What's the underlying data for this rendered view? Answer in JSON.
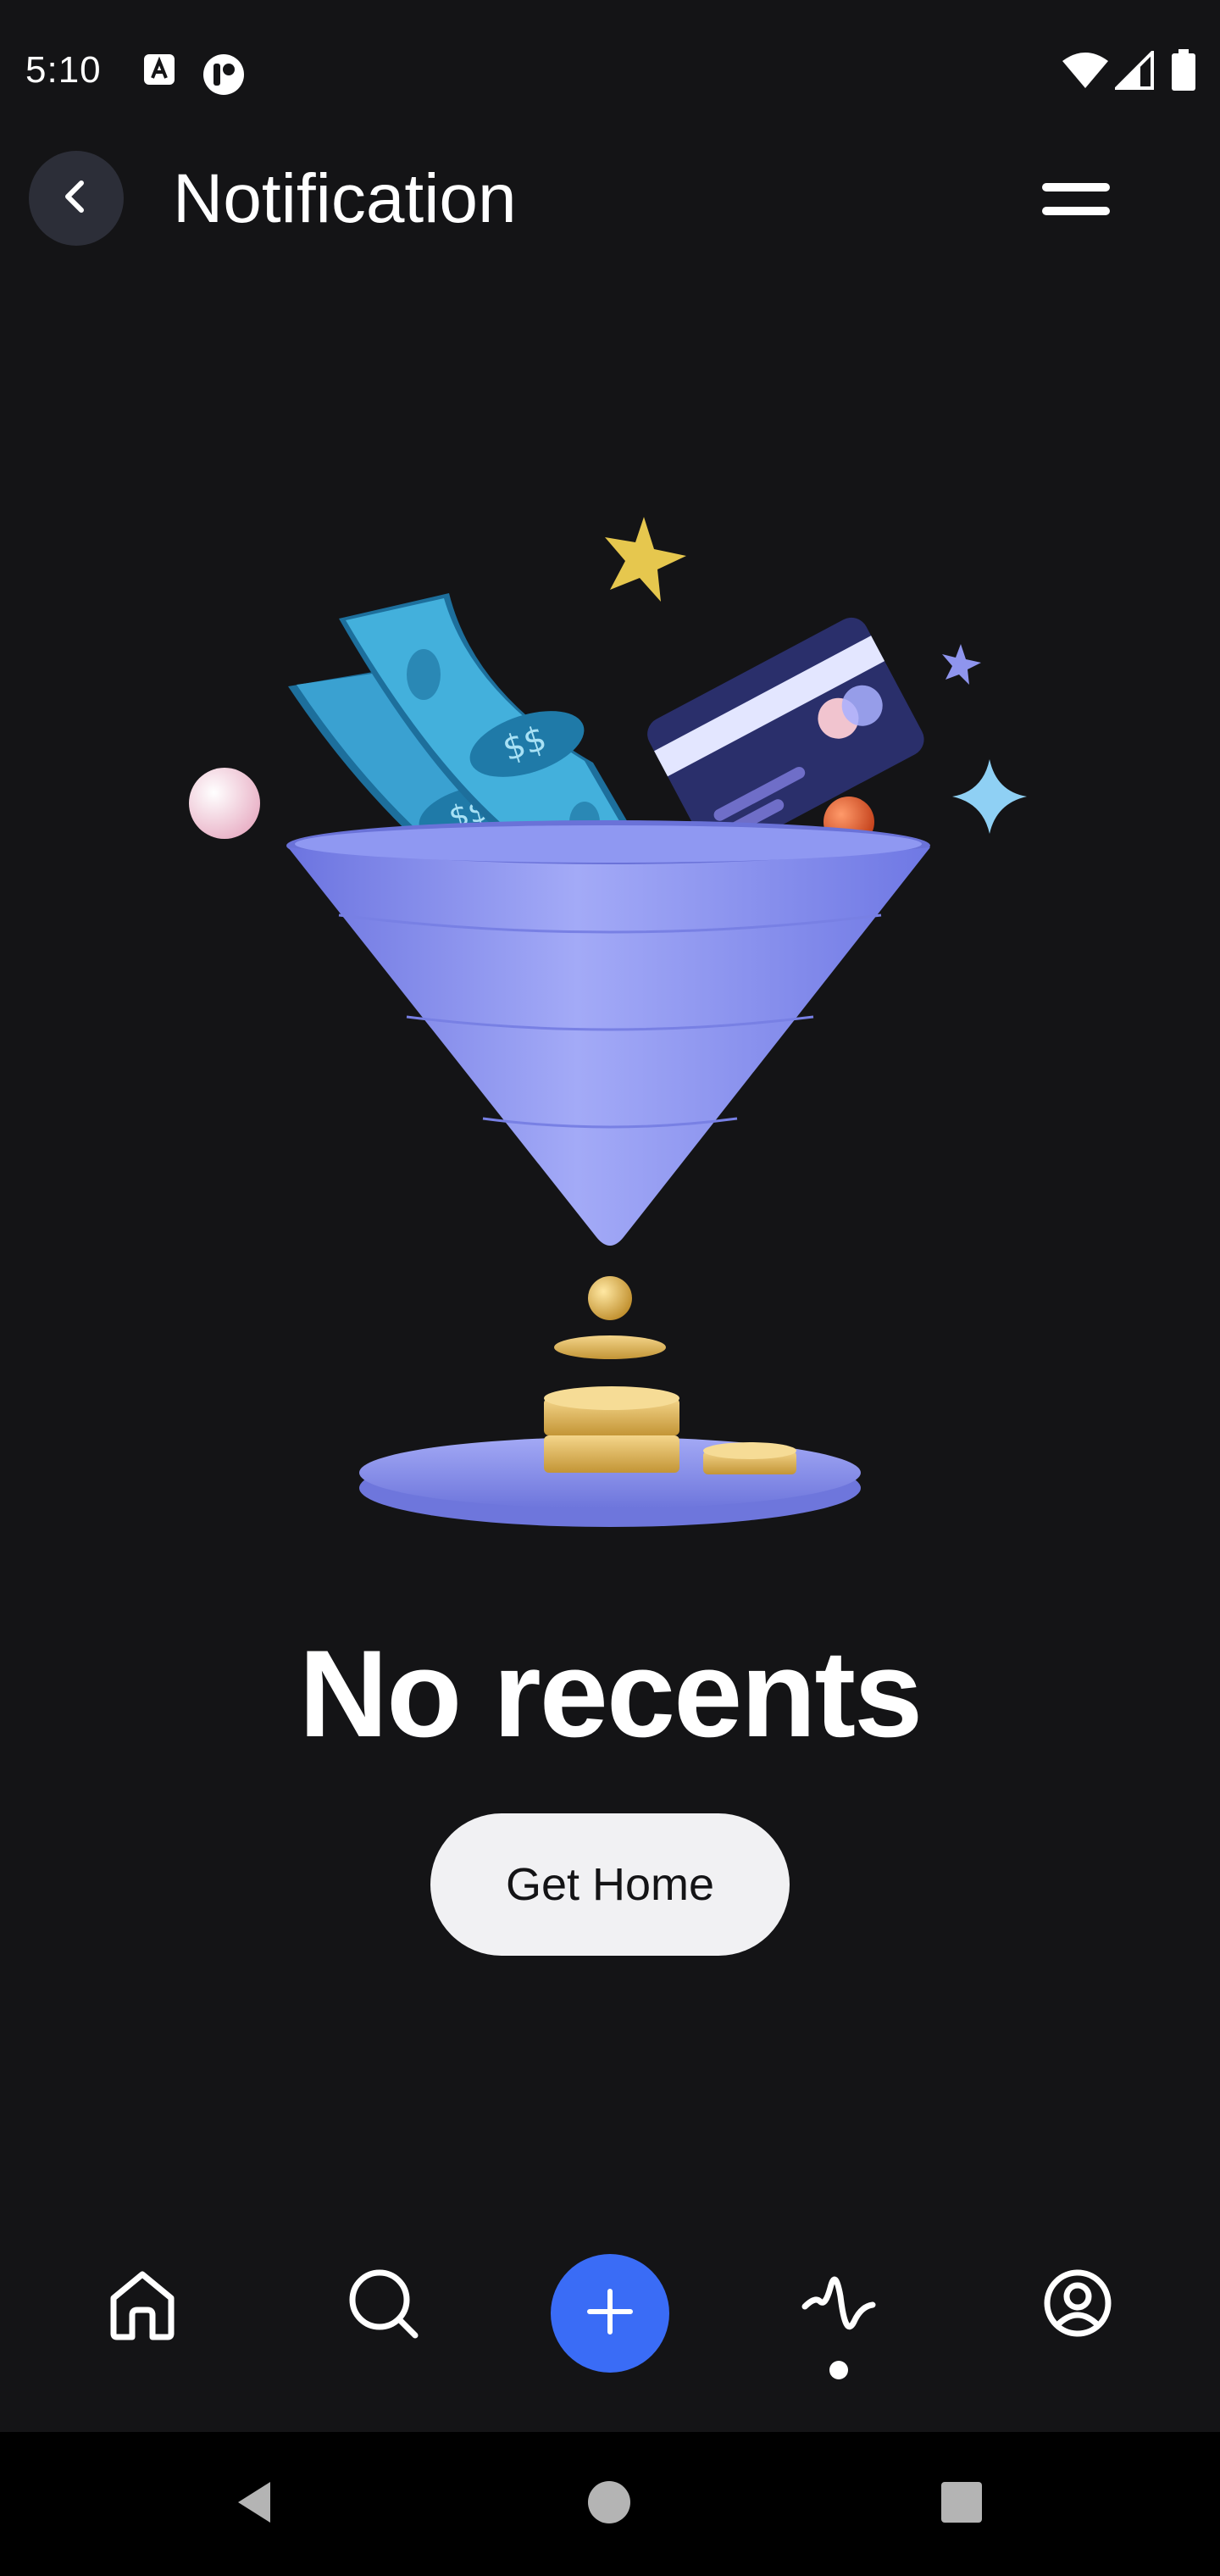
{
  "status_bar": {
    "time": "5:10",
    "icons": [
      "a-notification-icon",
      "app-notification-icon",
      "wifi-icon",
      "signal-icon",
      "battery-icon"
    ]
  },
  "header": {
    "title": "Notification",
    "back_icon": "chevron-left-icon",
    "menu_icon": "menu-icon"
  },
  "empty_state": {
    "title": "No recents",
    "button_label": "Get Home",
    "illustration": "funnel-money-illustration"
  },
  "bottom_nav": {
    "items": [
      {
        "icon": "home-icon"
      },
      {
        "icon": "search-icon"
      },
      {
        "icon": "plus-icon"
      },
      {
        "icon": "activity-icon",
        "active": true
      },
      {
        "icon": "profile-icon"
      }
    ]
  },
  "system_nav": {
    "items": [
      "back-triangle-icon",
      "home-circle-icon",
      "recents-square-icon"
    ]
  },
  "colors": {
    "background": "#141416",
    "accent": "#3a6cf6",
    "button_bg": "#f1f1f3",
    "funnel": "#8e97f3"
  }
}
